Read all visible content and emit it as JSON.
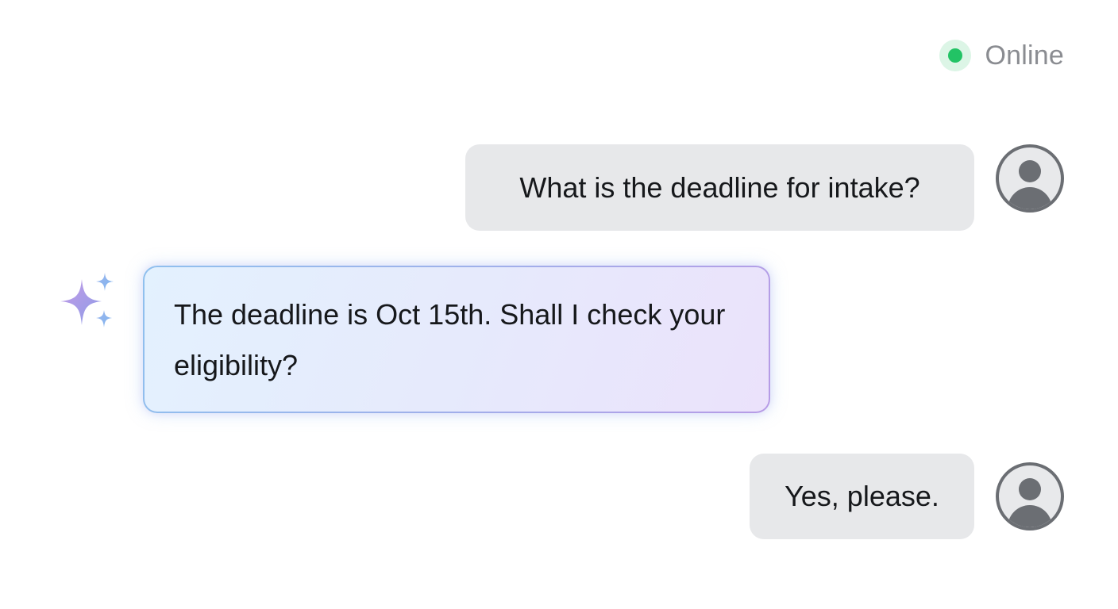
{
  "status": {
    "label": "Online",
    "dot_color": "#22c365"
  },
  "messages": [
    {
      "role": "user",
      "text": "What is the deadline for intake?"
    },
    {
      "role": "assistant",
      "text": "The deadline is Oct 15th. Shall I check your eligibility?"
    },
    {
      "role": "user",
      "text": "Yes, please."
    }
  ],
  "icons": {
    "assistant": "sparkle-icon",
    "user": "user-avatar-icon"
  },
  "colors": {
    "user_bubble": "#e7e8ea",
    "assistant_gradient_start": "#e3f1fe",
    "assistant_gradient_end": "#ebe2fb",
    "avatar": "#6b6e73"
  }
}
